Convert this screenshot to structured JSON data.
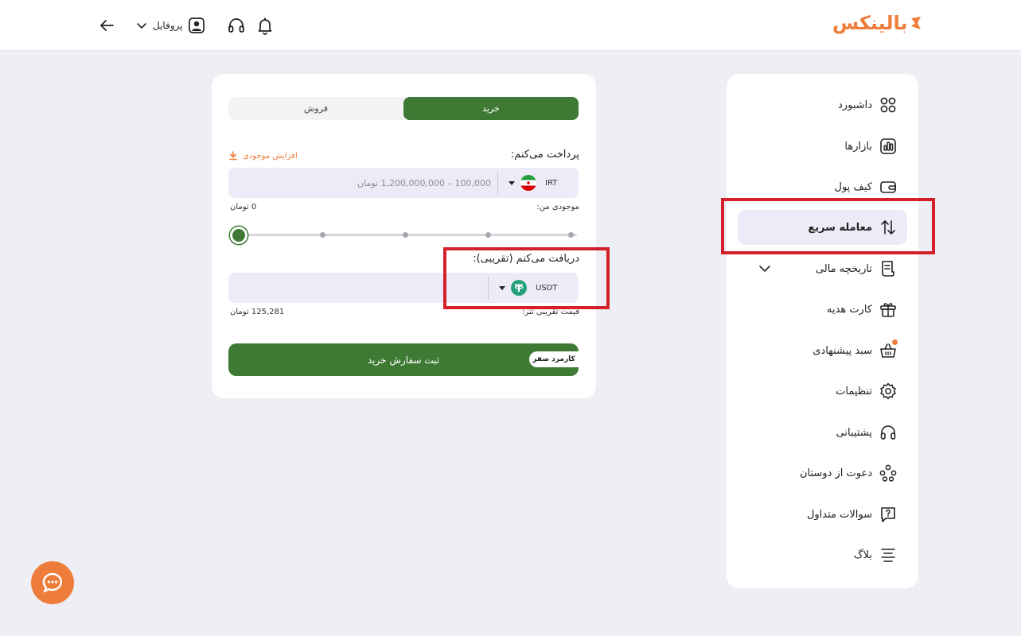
{
  "brand": {
    "name": "بالینکس",
    "color": "#ee7d3b"
  },
  "header": {
    "profile_label": "پروفایل",
    "icons": [
      "back-arrow-icon",
      "chevron-down-icon",
      "user-icon",
      "headset-icon",
      "bell-icon"
    ]
  },
  "sidebar": {
    "items": [
      {
        "label": "داشبورد",
        "icon": "dashboard-icon"
      },
      {
        "label": "بازارها",
        "icon": "markets-icon"
      },
      {
        "label": "کیف پول",
        "icon": "wallet-icon"
      },
      {
        "label": "معامله سریع",
        "icon": "swap-arrows-icon",
        "active": true
      },
      {
        "label": "تاریخچه مالی",
        "icon": "receipt-icon"
      },
      {
        "label": "کارت هدیه",
        "icon": "gift-icon"
      },
      {
        "label": "سبد پیشنهادی",
        "icon": "basket-icon"
      },
      {
        "label": "تنظیمات",
        "icon": "gear-icon"
      },
      {
        "label": "پشتیبانی",
        "icon": "headset-icon"
      },
      {
        "label": "دعوت از دوستان",
        "icon": "invite-icon"
      },
      {
        "label": "سوالات متداول",
        "icon": "faq-icon"
      },
      {
        "label": "بلاگ",
        "icon": "blog-icon"
      }
    ]
  },
  "trade": {
    "tabs": {
      "buy": "خرید",
      "sell": "فروش",
      "selected": "buy"
    },
    "pay": {
      "label": "پرداخت می‌کنم:",
      "topup": "افزایش موجودی",
      "placeholder": "100,000 – 1,200,000,000 تومان",
      "currency": "IRT",
      "balance_label": "موجودی من:",
      "balance_value": "0 تومان"
    },
    "slider": {
      "value_percent": 0,
      "steps": 5
    },
    "receive": {
      "label": "دریافت می‌کنم (تقریبی):",
      "currency": "USDT",
      "value": "",
      "price_label": "قیمت تقریبی تتر:",
      "price_value": "125,281 تومان"
    },
    "submit": {
      "label": "ثبت سفارش خرید",
      "badge": "کارمزد صفر"
    }
  },
  "colors": {
    "primary_green": "#3f7a35",
    "accent_orange": "#ee7d3b",
    "highlight_red": "#d3202b",
    "active_bg": "#ecebf7"
  }
}
